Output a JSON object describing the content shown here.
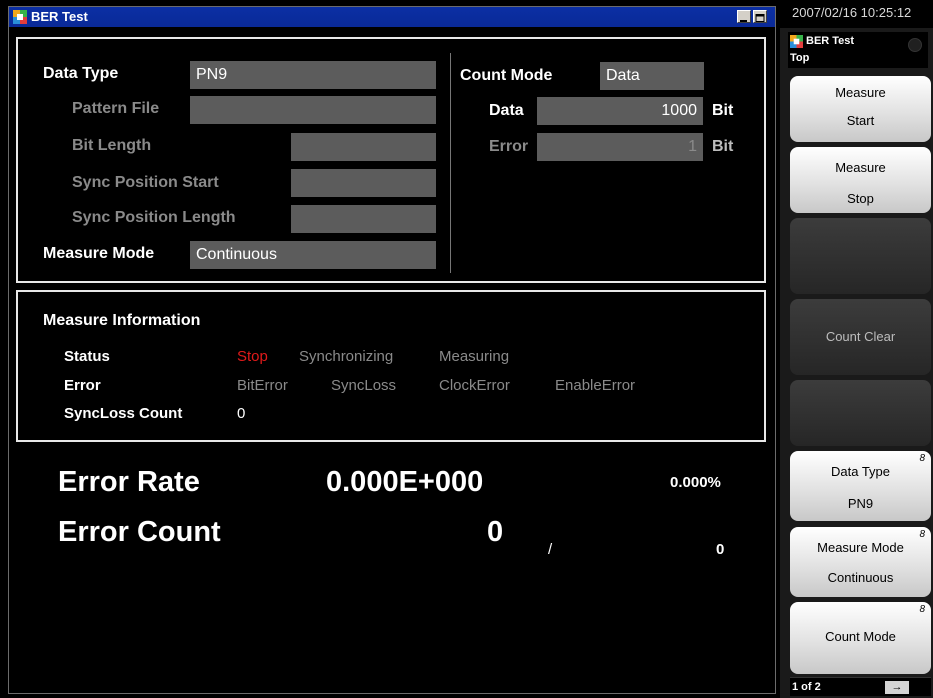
{
  "window": {
    "title": "BER Test"
  },
  "settings": {
    "data_type": {
      "label": "Data Type",
      "value": "PN9"
    },
    "pattern_file": {
      "label": "Pattern File",
      "value": ""
    },
    "bit_length": {
      "label": "Bit Length",
      "value": ""
    },
    "sync_position_start": {
      "label": "Sync Position Start",
      "value": ""
    },
    "sync_position_length": {
      "label": "Sync Position Length",
      "value": ""
    },
    "measure_mode": {
      "label": "Measure Mode",
      "value": "Continuous"
    },
    "count_mode": {
      "label": "Count Mode",
      "value": "Data"
    },
    "data": {
      "label": "Data",
      "value": "1000",
      "unit": "Bit"
    },
    "error": {
      "label": "Error",
      "value": "1",
      "unit": "Bit"
    }
  },
  "measure_info": {
    "title": "Measure Information",
    "status_label": "Status",
    "status_stop": "Stop",
    "status_synchronizing": "Synchronizing",
    "status_measuring": "Measuring",
    "error_label": "Error",
    "error_bit": "BitError",
    "error_syncloss": "SyncLoss",
    "error_clock": "ClockError",
    "error_enable": "EnableError",
    "syncloss_count_label": "SyncLoss Count",
    "syncloss_count_value": "0"
  },
  "results": {
    "error_rate_label": "Error Rate",
    "error_rate_value": "0.000E+000",
    "error_rate_percent": "0.000%",
    "error_count_label": "Error Count",
    "error_count_value": "0",
    "separator": "/",
    "total_count": "0"
  },
  "side": {
    "datetime": "2007/02/16 10:25:12",
    "app_title": "BER Test",
    "sub_title": "Top",
    "keys": {
      "measure_start": {
        "line1": "Measure",
        "line2": "Start"
      },
      "measure_stop": {
        "line1": "Measure",
        "line2": "Stop"
      },
      "count_clear": {
        "line1": "Count Clear"
      },
      "data_type": {
        "line1": "Data Type",
        "line2": "PN9"
      },
      "measure_mode": {
        "line1": "Measure Mode",
        "line2": "Continuous"
      },
      "count_mode": {
        "line1": "Count Mode"
      }
    },
    "page": "1 of 2"
  },
  "colors": {
    "accent_stop": "#e01a1a",
    "title_bar": "#0b2fa4",
    "field_bg": "#5c5c5c",
    "dim_text": "#8a8a8a"
  }
}
